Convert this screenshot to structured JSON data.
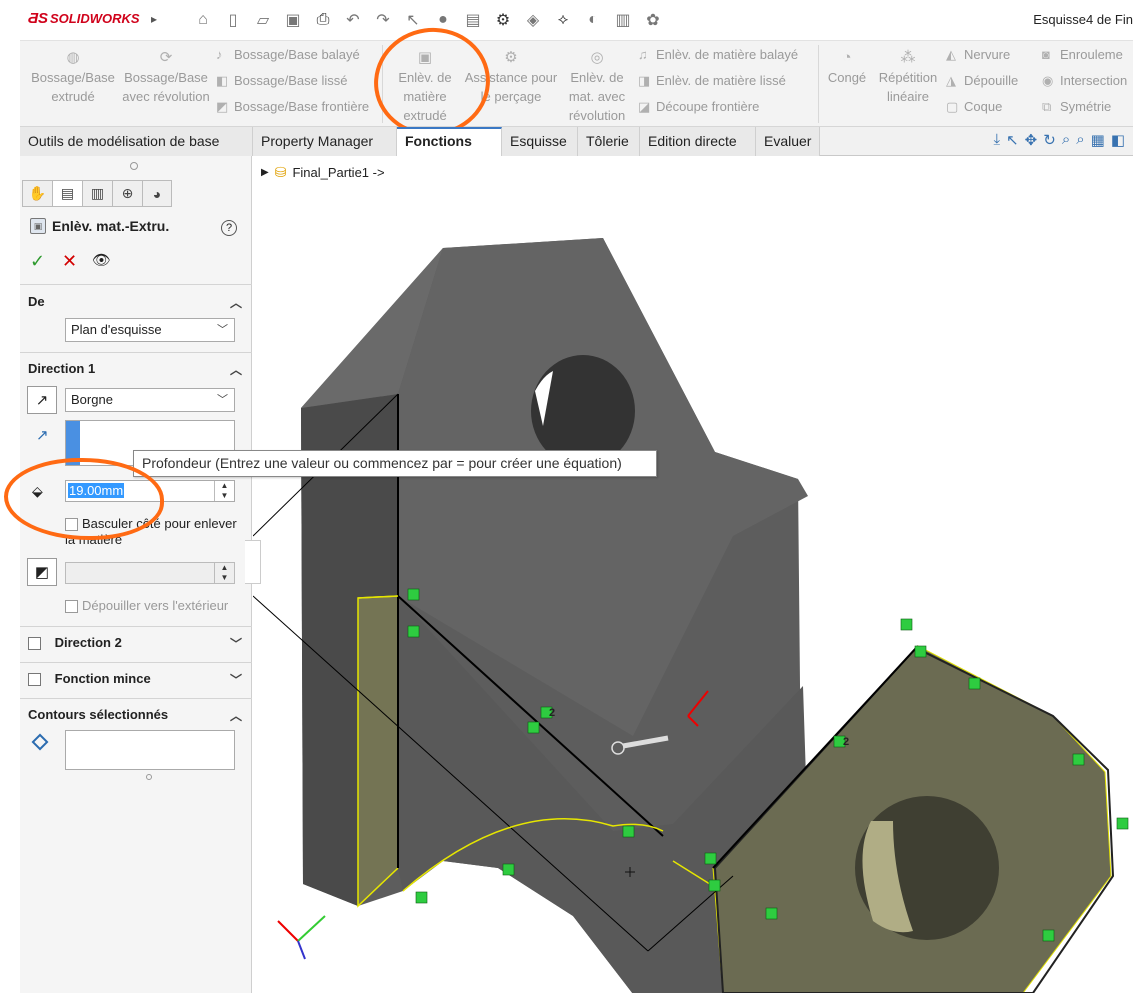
{
  "app": {
    "logo": "SOLIDWORKS",
    "document_title": "Esquisse4 de Fin"
  },
  "command_manager": {
    "large_items": [
      {
        "label": "Bossage/Base extrudé",
        "icon": "boss-extrude-icon"
      },
      {
        "label": "Bossage/Base avec révolution",
        "icon": "boss-revolve-icon"
      },
      {
        "label": "Enlèv. de matière extrudé",
        "icon": "cut-extrude-icon"
      },
      {
        "label": "Assistance pour le perçage",
        "icon": "hole-wizard-icon"
      },
      {
        "label": "Enlèv. de mat. avec révolution",
        "icon": "cut-revolve-icon"
      },
      {
        "label": "Congé",
        "icon": "fillet-icon"
      },
      {
        "label": "Répétition linéaire",
        "icon": "linear-pattern-icon"
      }
    ],
    "small_items": [
      {
        "label": "Bossage/Base balayé"
      },
      {
        "label": "Bossage/Base lissé"
      },
      {
        "label": "Bossage/Base frontière"
      },
      {
        "label": "Enlèv. de matière balayé"
      },
      {
        "label": "Enlèv. de matière lissé"
      },
      {
        "label": "Découpe frontière"
      },
      {
        "label": "Nervure"
      },
      {
        "label": "Dépouille"
      },
      {
        "label": "Coque"
      },
      {
        "label": "Enrouleme"
      },
      {
        "label": "Intersection"
      },
      {
        "label": "Symétrie"
      }
    ]
  },
  "tabs": [
    {
      "label": "Outils de modélisation de base"
    },
    {
      "label": "Property Manager"
    },
    {
      "label": "Fonctions",
      "active": true
    },
    {
      "label": "Esquisse"
    },
    {
      "label": "Tôlerie"
    },
    {
      "label": "Edition directe"
    },
    {
      "label": "Evaluer"
    }
  ],
  "property_manager": {
    "title": "Enlèv. mat.-Extru.",
    "sections": {
      "from": {
        "header": "De",
        "value": "Plan d'esquisse"
      },
      "direction1": {
        "header": "Direction 1",
        "end_condition": "Borgne",
        "depth": "19.00mm",
        "flip_side_label": "Basculer côté pour enlever la matière",
        "draft_label": "Dépouiller vers l'extérieur"
      },
      "direction2": {
        "header": "Direction 2"
      },
      "thin_feature": {
        "header": "Fonction mince"
      },
      "selected_contours": {
        "header": "Contours sélectionnés"
      }
    }
  },
  "tooltip": {
    "text": "Profondeur (Entrez une valeur ou commencez par = pour créer une équation)"
  },
  "viewport": {
    "tree_item": "Final_Partie1 ->",
    "relation_labels": [
      "2",
      "2"
    ]
  },
  "annotations": {
    "color": "#ff6a13"
  }
}
